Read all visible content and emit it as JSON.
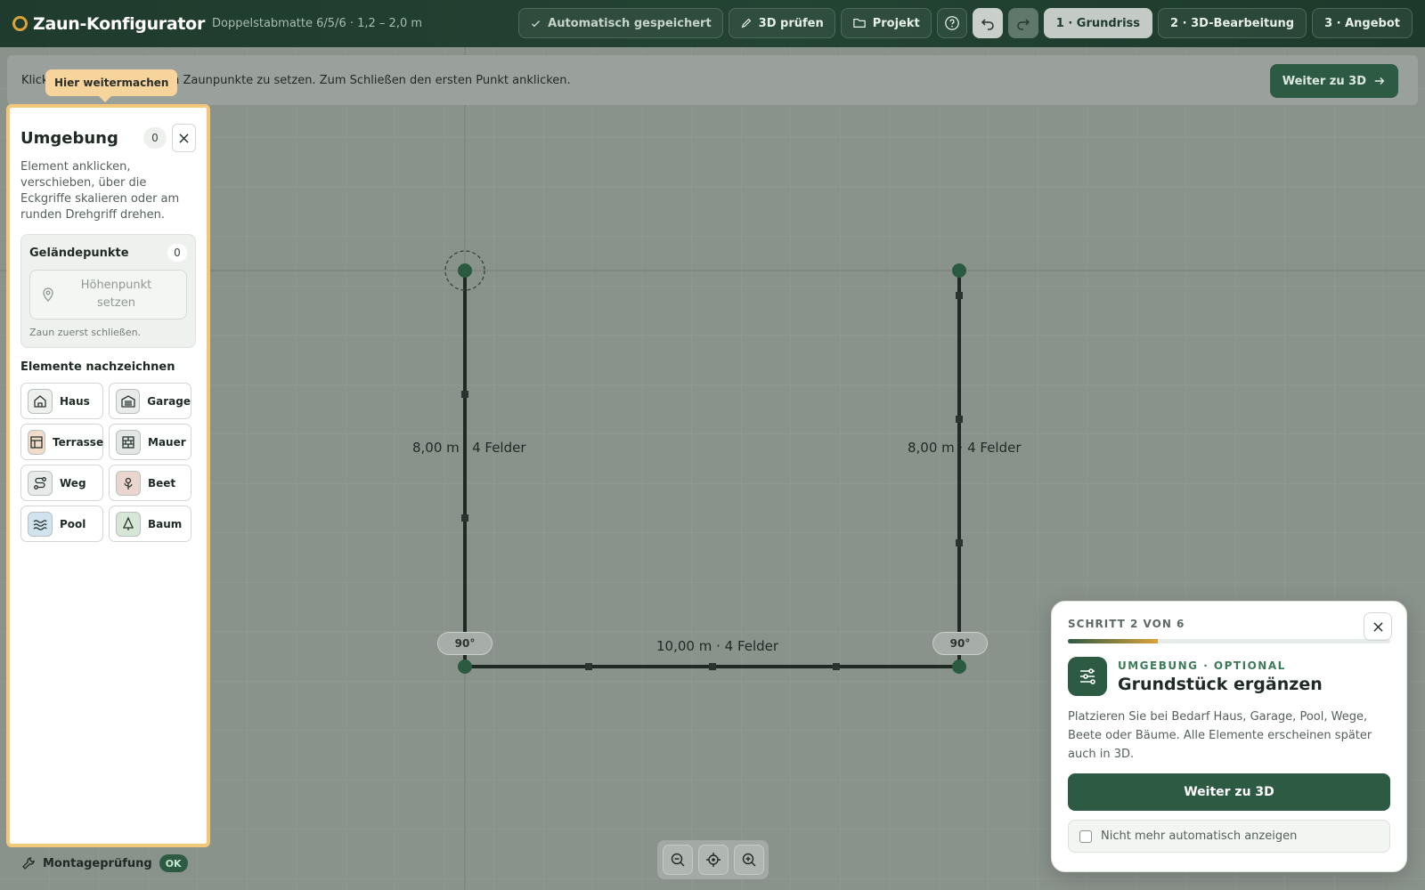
{
  "app": {
    "title": "Zaun-Konfigurator",
    "subtitle": "Doppelstabmatte 6/5/6 · 1,2 – 2,0 m"
  },
  "toolbar": {
    "saved_label": "Automatisch gespeichert",
    "check3d_label": "3D prüfen",
    "project_label": "Projekt",
    "steps": [
      {
        "label": "1 · Grundriss",
        "active": true
      },
      {
        "label": "2 · 3D-Bearbeitung",
        "active": false
      },
      {
        "label": "3 · Angebot",
        "active": false
      }
    ]
  },
  "hint": {
    "text_start": "Klick",
    "text_end": "um Zaunpunkte zu setzen. Zum Schließen den ersten Punkt anklicken.",
    "next_label": "Weiter zu 3D"
  },
  "tooltip": {
    "label": "Hier weitermachen"
  },
  "panel": {
    "title": "Umgebung",
    "count": "0",
    "description": "Element anklicken, verschieben, über die Eckgriffe skalieren oder am runden Drehgriff drehen.",
    "terrain": {
      "title": "Geländepunkte",
      "count": "0",
      "button_line1": "Höhenpunkt",
      "button_line2": "setzen",
      "note": "Zaun zuerst schließen."
    },
    "elements_title": "Elemente nachzeichnen",
    "elements": [
      {
        "label": "Haus",
        "icon": "house-icon",
        "bg": "#eef0ee"
      },
      {
        "label": "Garage",
        "icon": "garage-icon",
        "bg": "#e8ebe9"
      },
      {
        "label": "Terrasse",
        "icon": "terrace-icon",
        "bg": "#f0dcc8"
      },
      {
        "label": "Mauer",
        "icon": "wall-icon",
        "bg": "#e2e5e3"
      },
      {
        "label": "Weg",
        "icon": "path-icon",
        "bg": "#e8ebe9"
      },
      {
        "label": "Beet",
        "icon": "flowerbed-icon",
        "bg": "#ead6cf"
      },
      {
        "label": "Pool",
        "icon": "pool-icon",
        "bg": "#cfe4ef"
      },
      {
        "label": "Baum",
        "icon": "tree-icon",
        "bg": "#d6e7d8"
      }
    ]
  },
  "montage": {
    "label": "Montageprüfung",
    "status": "OK"
  },
  "canvas": {
    "left_label": "8,00 m · 4 Felder",
    "right_label": "8,00 m · 4 Felder",
    "bottom_label": "10,00 m · 4 Felder",
    "left_angle": "90°",
    "right_angle": "90°"
  },
  "card": {
    "step": "SCHRITT 2 VON 6",
    "progress": 0.28,
    "kicker": "UMGEBUNG · OPTIONAL",
    "title": "Grundstück ergänzen",
    "body": "Platzieren Sie bei Bedarf Haus, Garage, Pool, Wege, Beete oder Bäume. Alle Elemente erscheinen später auch in 3D.",
    "cta": "Weiter zu 3D",
    "checkbox_label": "Nicht mehr automatisch anzeigen"
  }
}
